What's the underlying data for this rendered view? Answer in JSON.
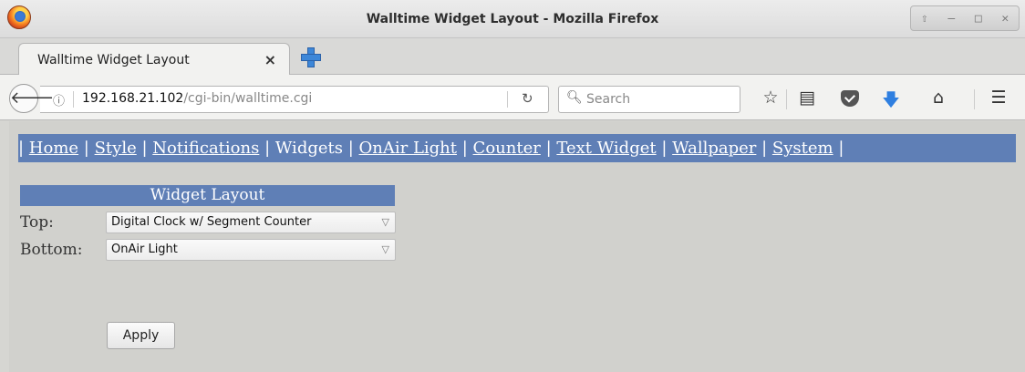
{
  "window": {
    "title": "Walltime Widget Layout - Mozilla Firefox",
    "controls": [
      "⇧",
      "–",
      "□",
      "✕"
    ]
  },
  "tab": {
    "label": "Walltime Widget Layout",
    "close": "×"
  },
  "navbar": {
    "url_host": "192.168.21.102",
    "url_path": "/cgi-bin/walltime.cgi",
    "search_placeholder": "Search",
    "icons": [
      "back-arrow-icon",
      "info-icon",
      "reload-icon",
      "search-icon",
      "bookmark-star-icon",
      "reading-list-icon",
      "pocket-icon",
      "download-icon",
      "home-icon",
      "menu-icon"
    ]
  },
  "menu": {
    "items": [
      "Home",
      "Style",
      "Notifications",
      "Widgets",
      "OnAir Light",
      "Counter",
      "Text Widget",
      "Wallpaper",
      "System"
    ]
  },
  "panel": {
    "title": "Widget Layout",
    "top_label": "Top:",
    "top_value": "Digital Clock w/ Segment Counter",
    "bottom_label": "Bottom:",
    "bottom_value": "OnAir Light",
    "apply_label": "Apply"
  },
  "colors": {
    "accent": "#5f7fb6",
    "content_bg": "#d1d1cd"
  }
}
